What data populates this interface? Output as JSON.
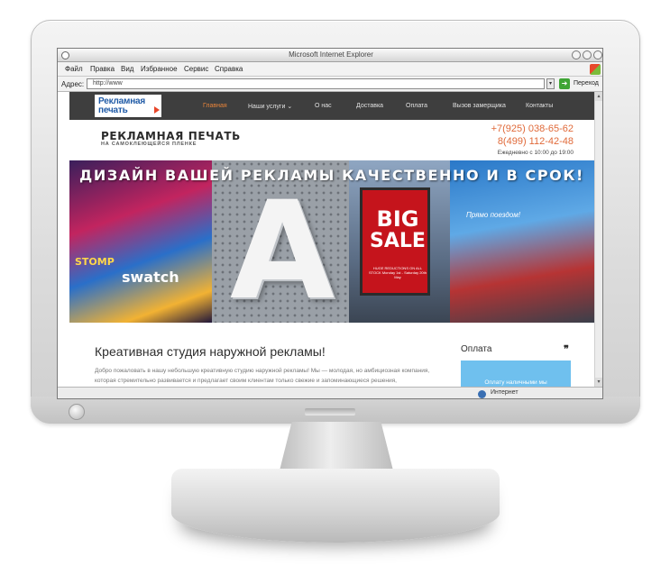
{
  "browser": {
    "title": "Microsoft Internet Explorer",
    "menu": [
      "Файл",
      "Правка",
      "Вид",
      "Избранное",
      "Сервис",
      "Справка"
    ],
    "address_label": "Адрес:",
    "address_value": "http://www",
    "go_label": "Переход",
    "status_zone": "Интернет"
  },
  "site": {
    "logo": {
      "line1": "Рекламная",
      "line2": "печать"
    },
    "nav": [
      "Главная",
      "Наши услуги ⌄",
      "О нас",
      "Доставка",
      "Оплата",
      "Вызов замерщика",
      "Контакты"
    ],
    "brand_title": "РЕКЛАМНАЯ ПЕЧАТЬ",
    "brand_subtitle": "НА САМОКЛЕЮЩЕЙСЯ ПЛЕНКЕ",
    "phone1": "+7(925) 038-65-62",
    "phone2": "8(499) 112-42-48",
    "hours": "Ежедневно с 10:00 до 19:00",
    "banner": {
      "headline": "ДИЗАЙН ВАШЕЙ РЕКЛАМЫ КАЧЕСТВЕННО И В СРОК!",
      "letter": "A",
      "poster_line1": "BIG",
      "poster_line2": "SALE",
      "poster_small": "HUGE REDUCTIONS ON ALL STOCK Monday 1st - Saturday 20th May",
      "sign_stomp": "STOMP",
      "sign_swatch": "swatch",
      "billboard_text": "Прямо поездом!"
    },
    "content_title": "Креативная студия наружной рекламы!",
    "content_text": "Добро пожаловать в нашу небольшую креативную студию наружной рекламы! Мы — молодая, но амбициозная компания, которая стремительно развивается и предлагает своим клиентам только свежие и запоминающиеся решения, привлекающие",
    "sidebar_title": "Оплата",
    "sidebar_quote": "❞",
    "sidebar_button": "Оплату наличными мы"
  }
}
